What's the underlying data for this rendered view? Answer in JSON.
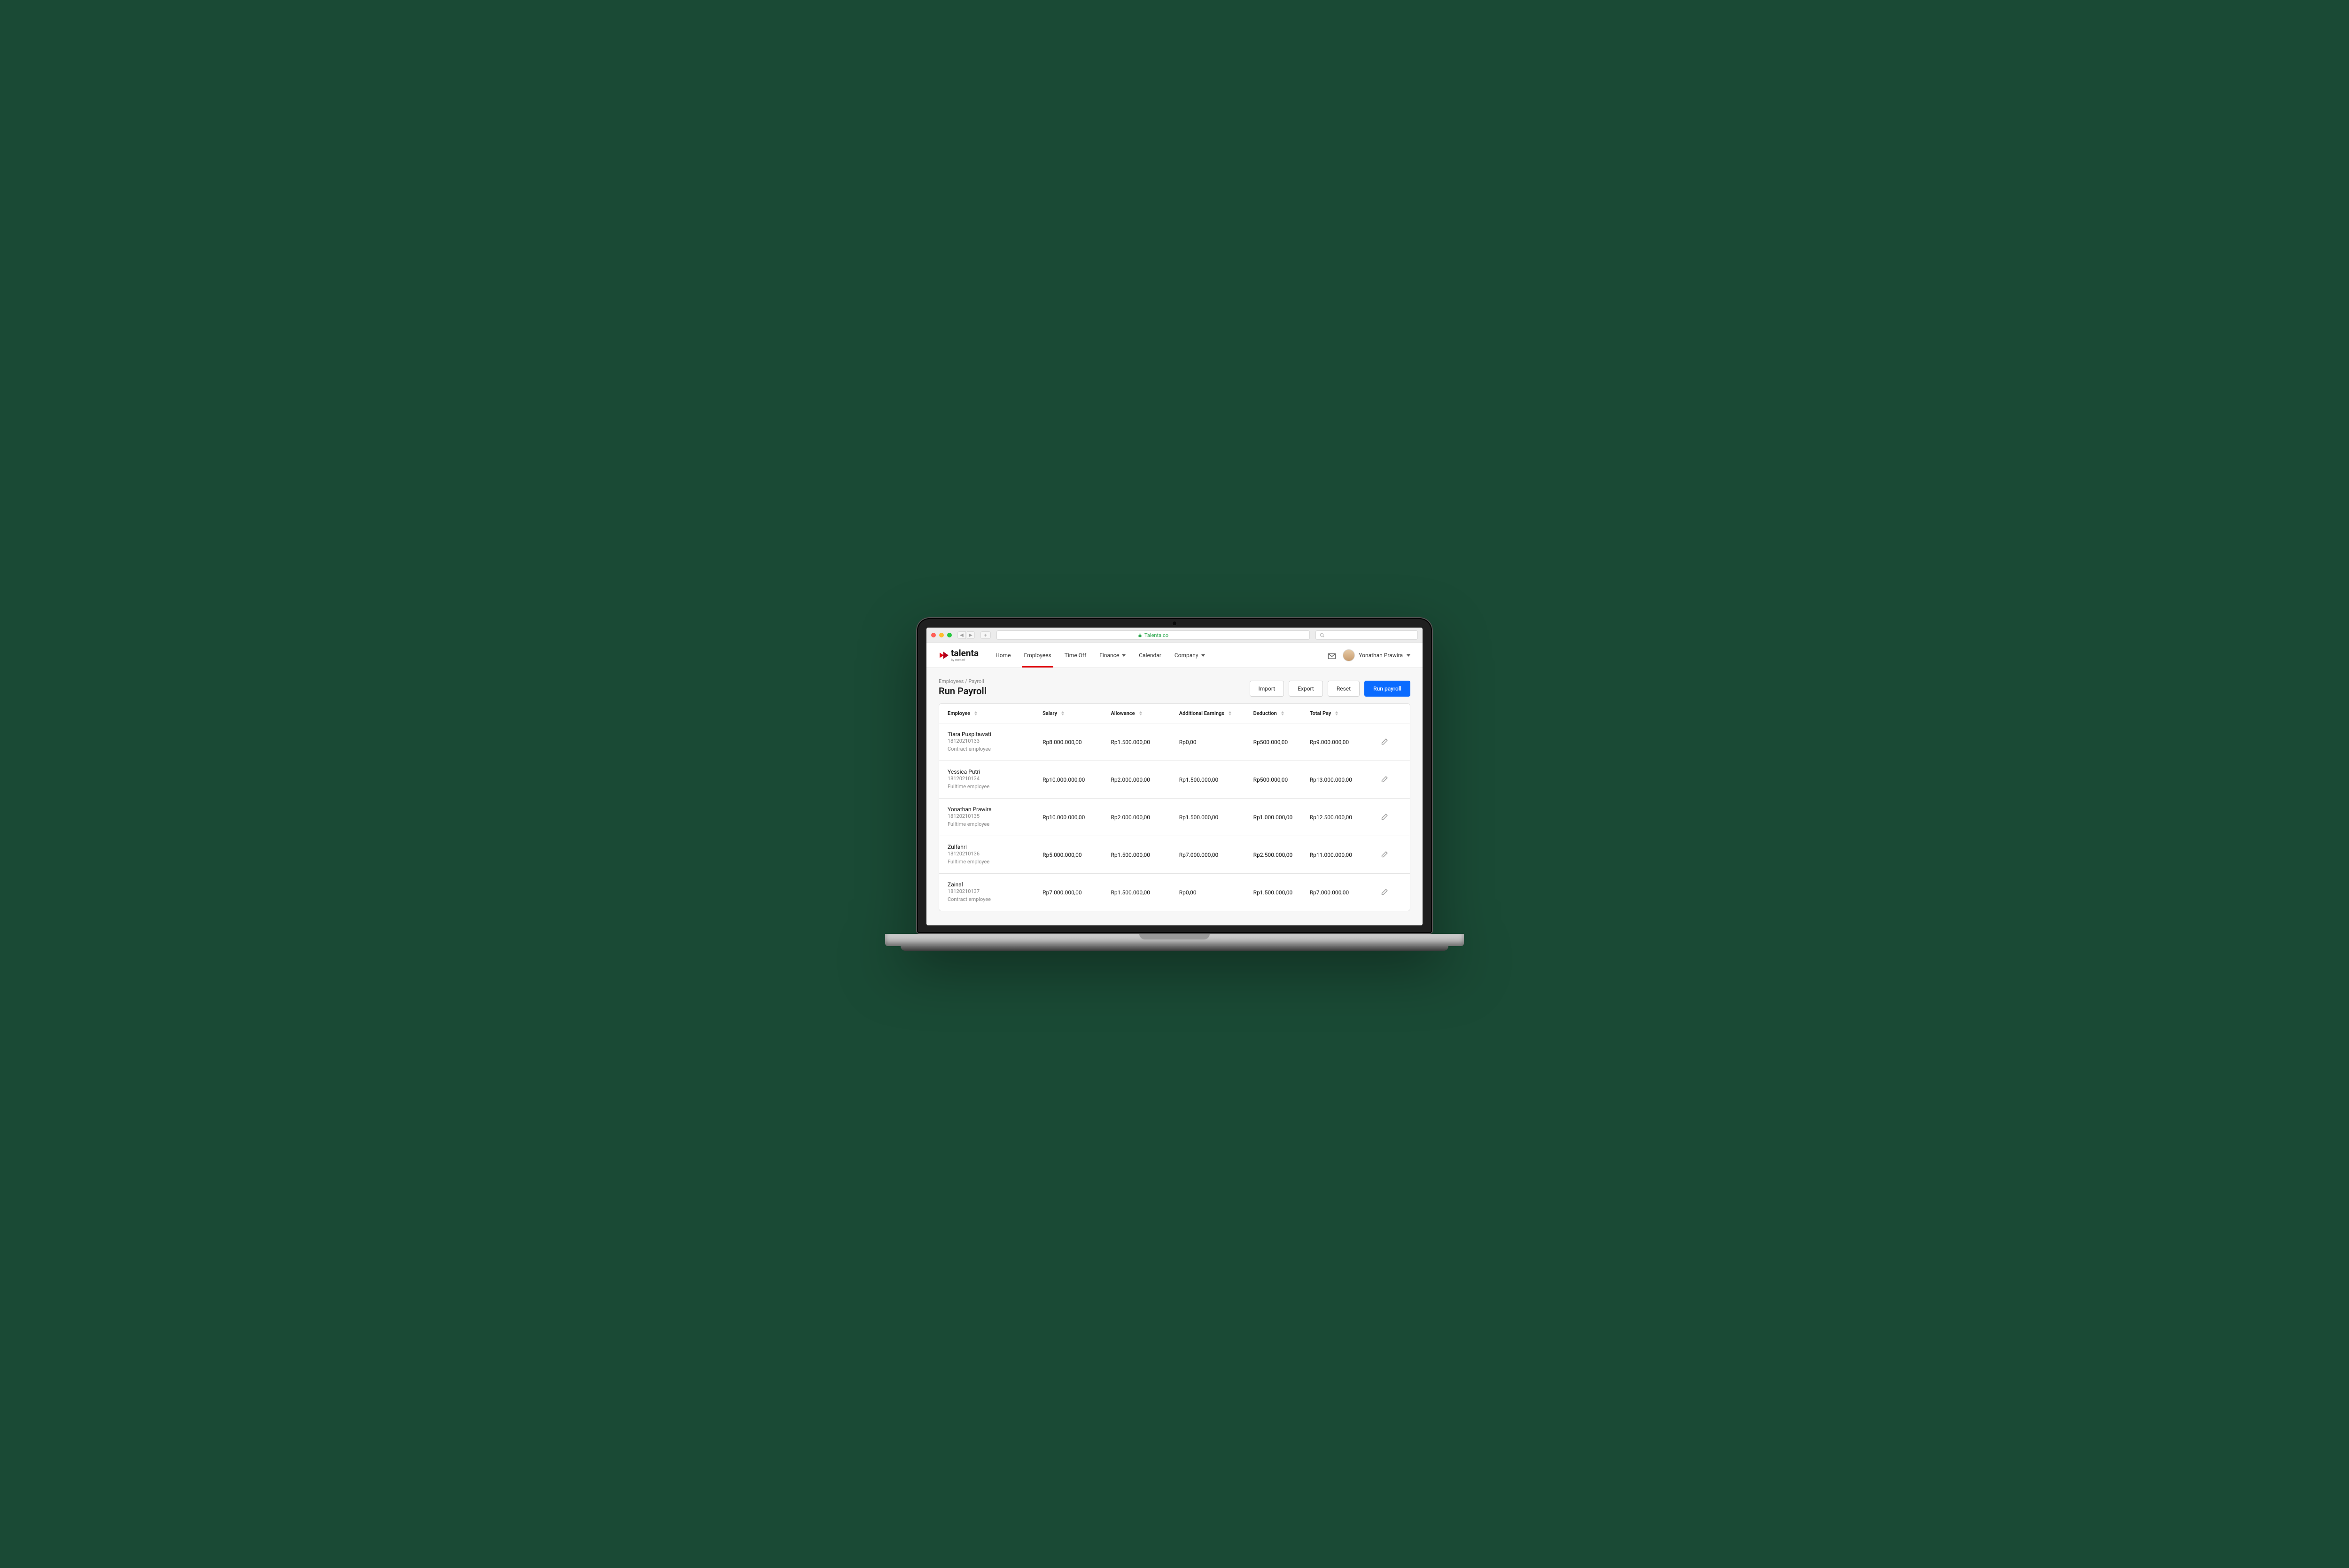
{
  "browser": {
    "url_display": "Talenta.co"
  },
  "brand": {
    "name": "talenta",
    "tagline": "by mekari"
  },
  "nav": {
    "items": [
      {
        "label": "Home",
        "active": false,
        "dropdown": false
      },
      {
        "label": "Employees",
        "active": true,
        "dropdown": false
      },
      {
        "label": "Time Off",
        "active": false,
        "dropdown": false
      },
      {
        "label": "Finance",
        "active": false,
        "dropdown": true
      },
      {
        "label": "Calendar",
        "active": false,
        "dropdown": false
      },
      {
        "label": "Company",
        "active": false,
        "dropdown": true
      }
    ],
    "user_name": "Yonathan Prawira"
  },
  "page": {
    "breadcrumb": "Employees / Payroll",
    "title": "Run Payroll",
    "buttons": {
      "import": "Import",
      "export": "Export",
      "reset": "Reset",
      "run": "Run payroll"
    }
  },
  "table": {
    "columns": [
      "Employee",
      "Salary",
      "Allowance",
      "Additional Earnings",
      "Deduction",
      "Total Pay"
    ],
    "rows": [
      {
        "name": "Tiara Puspitawati",
        "id": "18120210133",
        "type": "Contract employee",
        "salary": "Rp8.000.000,00",
        "allowance": "Rp1.500.000,00",
        "additional": "Rp0,00",
        "deduction": "Rp500.000,00",
        "total": "Rp9.000.000,00"
      },
      {
        "name": "Yessica Putri",
        "id": "18120210134",
        "type": "Fulltime employee",
        "salary": "Rp10.000.000,00",
        "allowance": "Rp2.000.000,00",
        "additional": "Rp1.500.000,00",
        "deduction": "Rp500.000,00",
        "total": "Rp13.000.000,00"
      },
      {
        "name": "Yonathan Prawira",
        "id": "18120210135",
        "type": "Fulltime employee",
        "salary": "Rp10.000.000,00",
        "allowance": "Rp2.000.000,00",
        "additional": "Rp1.500.000,00",
        "deduction": "Rp1.000.000,00",
        "total": "Rp12.500.000,00"
      },
      {
        "name": "Zulfahri",
        "id": "18120210136",
        "type": "Fulltime employee",
        "salary": "Rp5.000.000,00",
        "allowance": "Rp1.500.000,00",
        "additional": "Rp7.000.000,00",
        "deduction": "Rp2.500.000,00",
        "total": "Rp11.000.000,00"
      },
      {
        "name": "Zainal",
        "id": "18120210137",
        "type": "Contract employee",
        "salary": "Rp7.000.000,00",
        "allowance": "Rp1.500.000,00",
        "additional": "Rp0,00",
        "deduction": "Rp1.500.000,00",
        "total": "Rp7.000.000,00"
      }
    ]
  }
}
